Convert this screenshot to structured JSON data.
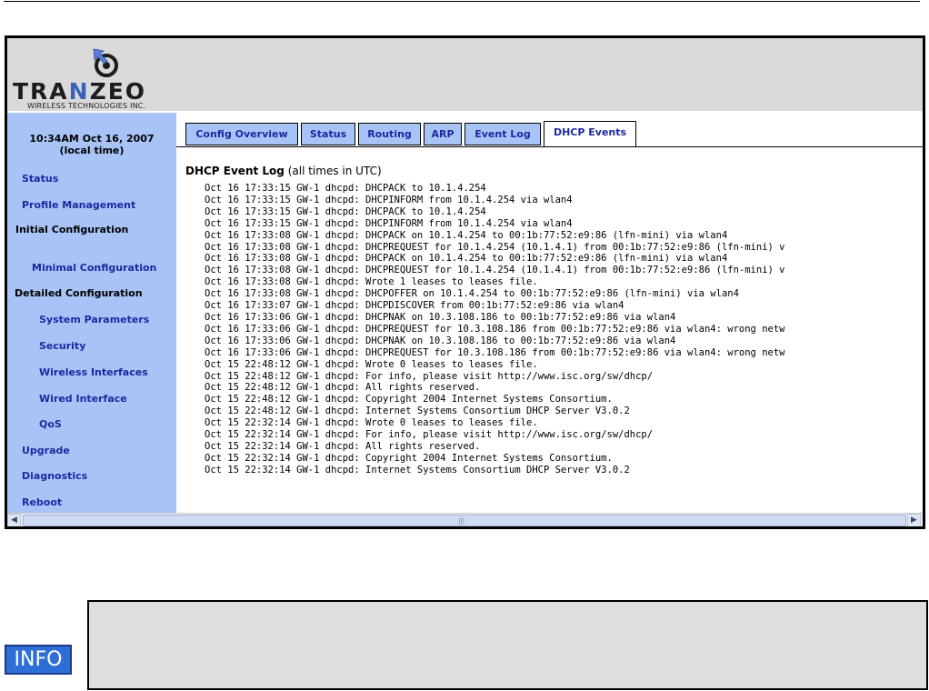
{
  "brand": {
    "name_part1": "TRA",
    "name_part2": "N",
    "name_part3": "ZEO",
    "tagline": "WIRELESS TECHNOLOGIES INC."
  },
  "clock": {
    "time": "10:34AM Oct 16, 2007",
    "zone": "(local time)"
  },
  "sidebar": {
    "items": [
      {
        "label": "Status"
      },
      {
        "label": "Profile Management"
      },
      {
        "label": "Initial Configuration"
      },
      {
        "label": "Minimal Configuration"
      },
      {
        "label": "Detailed Configuration"
      },
      {
        "label": "System Parameters"
      },
      {
        "label": "Security"
      },
      {
        "label": "Wireless Interfaces"
      },
      {
        "label": "Wired Interface"
      },
      {
        "label": "QoS"
      },
      {
        "label": "Upgrade"
      },
      {
        "label": "Diagnostics"
      },
      {
        "label": "Reboot"
      }
    ]
  },
  "tabs": [
    {
      "label": "Config Overview"
    },
    {
      "label": "Status"
    },
    {
      "label": "Routing"
    },
    {
      "label": "ARP"
    },
    {
      "label": "Event Log"
    },
    {
      "label": "DHCP Events"
    }
  ],
  "active_tab": "DHCP Events",
  "log": {
    "title_bold": "DHCP Event Log",
    "title_rest": " (all times in UTC)",
    "lines": [
      "Oct 16 17:33:15 GW-1 dhcpd: DHCPACK to 10.1.4.254",
      "Oct 16 17:33:15 GW-1 dhcpd: DHCPINFORM from 10.1.4.254 via wlan4",
      "Oct 16 17:33:15 GW-1 dhcpd: DHCPACK to 10.1.4.254",
      "Oct 16 17:33:15 GW-1 dhcpd: DHCPINFORM from 10.1.4.254 via wlan4",
      "Oct 16 17:33:08 GW-1 dhcpd: DHCPACK on 10.1.4.254 to 00:1b:77:52:e9:86 (lfn-mini) via wlan4",
      "Oct 16 17:33:08 GW-1 dhcpd: DHCPREQUEST for 10.1.4.254 (10.1.4.1) from 00:1b:77:52:e9:86 (lfn-mini) v",
      "Oct 16 17:33:08 GW-1 dhcpd: DHCPACK on 10.1.4.254 to 00:1b:77:52:e9:86 (lfn-mini) via wlan4",
      "Oct 16 17:33:08 GW-1 dhcpd: DHCPREQUEST for 10.1.4.254 (10.1.4.1) from 00:1b:77:52:e9:86 (lfn-mini) v",
      "Oct 16 17:33:08 GW-1 dhcpd: Wrote 1 leases to leases file.",
      "Oct 16 17:33:08 GW-1 dhcpd: DHCPOFFER on 10.1.4.254 to 00:1b:77:52:e9:86 (lfn-mini) via wlan4",
      "Oct 16 17:33:07 GW-1 dhcpd: DHCPDISCOVER from 00:1b:77:52:e9:86 via wlan4",
      "Oct 16 17:33:06 GW-1 dhcpd: DHCPNAK on 10.3.108.186 to 00:1b:77:52:e9:86 via wlan4",
      "Oct 16 17:33:06 GW-1 dhcpd: DHCPREQUEST for 10.3.108.186 from 00:1b:77:52:e9:86 via wlan4: wrong netw",
      "Oct 16 17:33:06 GW-1 dhcpd: DHCPNAK on 10.3.108.186 to 00:1b:77:52:e9:86 via wlan4",
      "Oct 16 17:33:06 GW-1 dhcpd: DHCPREQUEST for 10.3.108.186 from 00:1b:77:52:e9:86 via wlan4: wrong netw",
      "Oct 15 22:48:12 GW-1 dhcpd: Wrote 0 leases to leases file.",
      "Oct 15 22:48:12 GW-1 dhcpd: For info, please visit http://www.isc.org/sw/dhcp/",
      "Oct 15 22:48:12 GW-1 dhcpd: All rights reserved.",
      "Oct 15 22:48:12 GW-1 dhcpd: Copyright 2004 Internet Systems Consortium.",
      "Oct 15 22:48:12 GW-1 dhcpd: Internet Systems Consortium DHCP Server V3.0.2",
      "Oct 15 22:32:14 GW-1 dhcpd: Wrote 0 leases to leases file.",
      "Oct 15 22:32:14 GW-1 dhcpd: For info, please visit http://www.isc.org/sw/dhcp/",
      "Oct 15 22:32:14 GW-1 dhcpd: All rights reserved.",
      "Oct 15 22:32:14 GW-1 dhcpd: Copyright 2004 Internet Systems Consortium.",
      "Oct 15 22:32:14 GW-1 dhcpd: Internet Systems Consortium DHCP Server V3.0.2"
    ]
  },
  "scrollbar": {
    "left_icon": "chevron-left-icon",
    "right_icon": "chevron-right-icon",
    "grip": "|||"
  },
  "info_label": "INFO",
  "colors": {
    "sidebar_bg": "#a8c4f7",
    "header_bg": "#d9d9d9",
    "link": "#1a2aa0",
    "brand_accent": "#3a63b8",
    "info_blue": "#2d6fd6"
  }
}
